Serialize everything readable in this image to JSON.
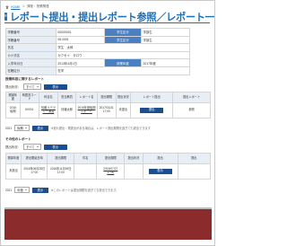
{
  "breadcrumb": [
    "HOME",
    "課程・授業関連"
  ],
  "page_title": "レポート提出・提出レポート参照／レポート一覧",
  "student_info": {
    "rows": [
      [
        {
          "label": "学籍番号",
          "value": "00000001"
        },
        {
          "label2": "学生区分",
          "value2": "学部生"
        }
      ],
      [
        {
          "label": "学籍番号",
          "value": "08 0001"
        },
        {
          "label2": "学生区分",
          "value2": "学部生"
        }
      ],
      [
        {
          "label": "氏名",
          "value": "学生　太郎"
        },
        {
          "label2": "",
          "value2": ""
        }
      ],
      [
        {
          "label": "カナ氏名",
          "value": "ガクセイ　タロウ"
        },
        {
          "label2": "",
          "value2": ""
        }
      ],
      [
        {
          "label": "入学年月日",
          "value": "2013年4月1日"
        },
        {
          "label2": "修業年度",
          "value2": "2017年度"
        }
      ],
      [
        {
          "label": "在籍区分",
          "value": "在学"
        },
        {
          "label2": "",
          "value2": ""
        }
      ]
    ]
  },
  "section1": {
    "title": "授業科目に関するレポート",
    "filter_label": "提出状況：",
    "filter_value": "すべて",
    "show_button": "表示",
    "headers": [
      "開講年度",
      "時間割コード",
      "科目名",
      "担当教員",
      "レポート名",
      "提出期限",
      "提出状況",
      "レポート提出",
      "提出レポート"
    ],
    "rows": [
      [
        "2016\n後期",
        "K0001",
        "情報リテラシー演習",
        "情報太郎",
        "2016年度後期レポート",
        "2017/01/31\n17:00",
        "未提出",
        "提出",
        "参照"
      ]
    ],
    "year_label": "2021",
    "year_select": "後期",
    "year_button": "表示",
    "note": "※遅れ提出・再提出がある場合は、レポート提出期限を過ぎても提出できます"
  },
  "section2": {
    "title": "その他のレポート",
    "filter_label": "提出状況：",
    "filter_value": "すべて",
    "show_button": "表示",
    "headers": [
      "開講年度",
      "提出開始日時",
      "提出期限",
      "件名",
      "提出期限",
      "提出状況",
      "提出",
      "提出"
    ],
    "rows": [
      [
        "未提出",
        "2016年06月28日\n17:00",
        "2016年11月09日\n17:00",
        "",
        "2016/07/27\n17:00",
        "",
        "表示",
        ""
      ]
    ],
    "year_label": "2021",
    "year_select": "年度",
    "year_button": "表示",
    "note": "※このレポートは提出期限を過ぎても提出できます。"
  },
  "colors": {
    "accent": "#1c6fb8",
    "banner": "#8c2b2b",
    "button": "#1c4f8f"
  }
}
